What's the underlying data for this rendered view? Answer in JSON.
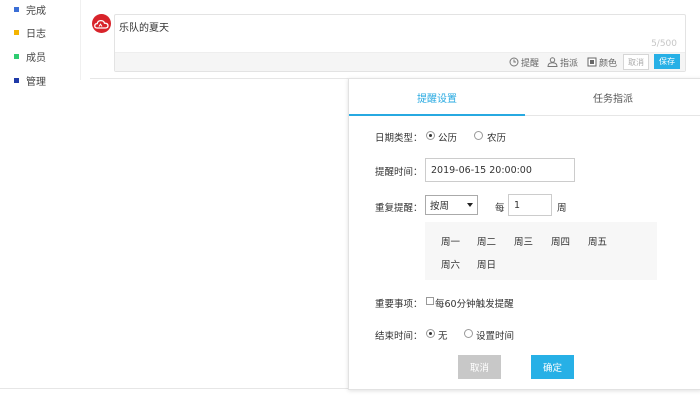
{
  "sidebar": {
    "items": [
      {
        "label": "完成",
        "color": "#3b6fd6"
      },
      {
        "label": "日志",
        "color": "#f4b400"
      },
      {
        "label": "成员",
        "color": "#2ecc71"
      },
      {
        "label": "管理",
        "color": "#1f3aa8"
      }
    ]
  },
  "editor": {
    "text": "乐队的夏天",
    "counter": "5/500",
    "toolbar": {
      "remind": "提醒",
      "assign": "指派",
      "color": "颜色",
      "cancel": "取消",
      "save": "保存"
    }
  },
  "panel": {
    "tabs": [
      {
        "label": "提醒设置",
        "active": true
      },
      {
        "label": "任务指派",
        "active": false
      }
    ],
    "date_type": {
      "label": "日期类型：",
      "options": [
        {
          "label": "公历",
          "checked": true
        },
        {
          "label": "农历",
          "checked": false
        }
      ]
    },
    "remind_time": {
      "label": "提醒时间：",
      "value": "2019-06-15 20:00:00"
    },
    "repeat": {
      "label": "重复提醒：",
      "selected": "按周",
      "every_label": "每",
      "interval": "1",
      "unit": "周"
    },
    "weekdays": [
      "周一",
      "周二",
      "周三",
      "周四",
      "周五",
      "周六",
      "周日"
    ],
    "important": {
      "label": "重要事项：",
      "checkbox_label": "每60分钟触发提醒",
      "checked": false
    },
    "end_time": {
      "label": "结束时间：",
      "options": [
        {
          "label": "无",
          "checked": true
        },
        {
          "label": "设置时间",
          "checked": false
        }
      ]
    },
    "buttons": {
      "cancel": "取消",
      "ok": "确定"
    }
  },
  "colors": {
    "accent": "#27b0e6",
    "avatar": "#d8232a"
  }
}
